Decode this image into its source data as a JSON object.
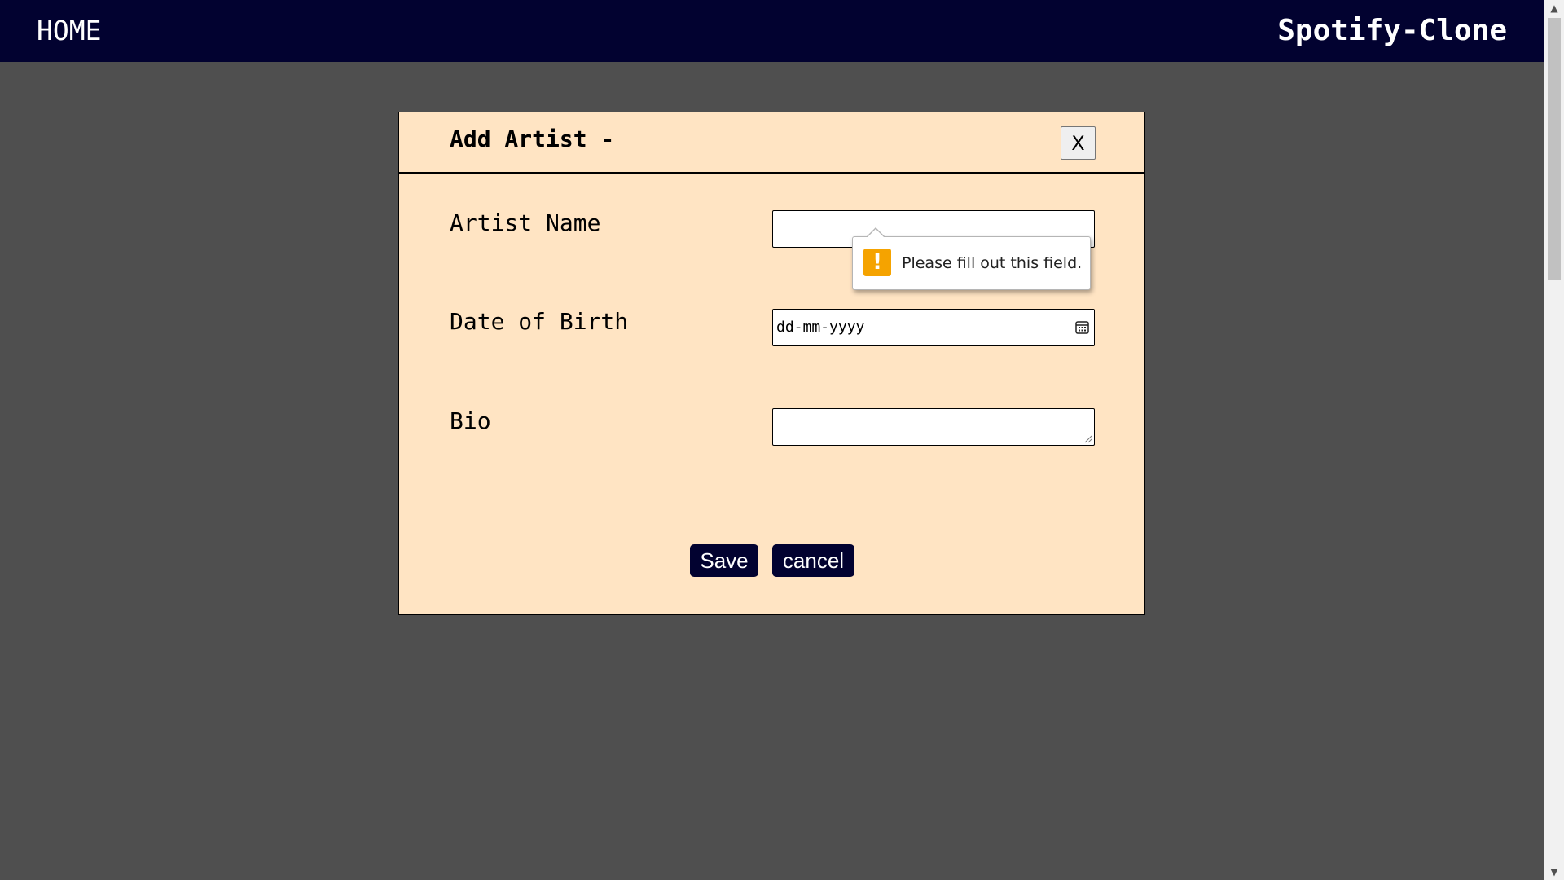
{
  "topbar": {
    "home_label": "HOME",
    "brand": "Spotify-Clone"
  },
  "modal": {
    "title": "Add Artist -",
    "close_label": "X",
    "fields": {
      "artist_name_label": "Artist Name",
      "artist_name_value": "",
      "dob_label": "Date of Birth",
      "dob_placeholder": "dd-mm-yyyy",
      "bio_label": "Bio",
      "bio_value": ""
    },
    "validation_message": "Please fill out this field.",
    "warning_glyph": "!",
    "save_label": "Save",
    "cancel_label": "cancel"
  },
  "colors": {
    "navbar": "#020230",
    "page_background": "#4f4f4f",
    "modal_background": "#ffe4c3",
    "warning": "#f5a300"
  },
  "icons": {
    "calendar": "calendar-icon",
    "warning": "warning-icon",
    "resize": "resize-grip-icon"
  }
}
